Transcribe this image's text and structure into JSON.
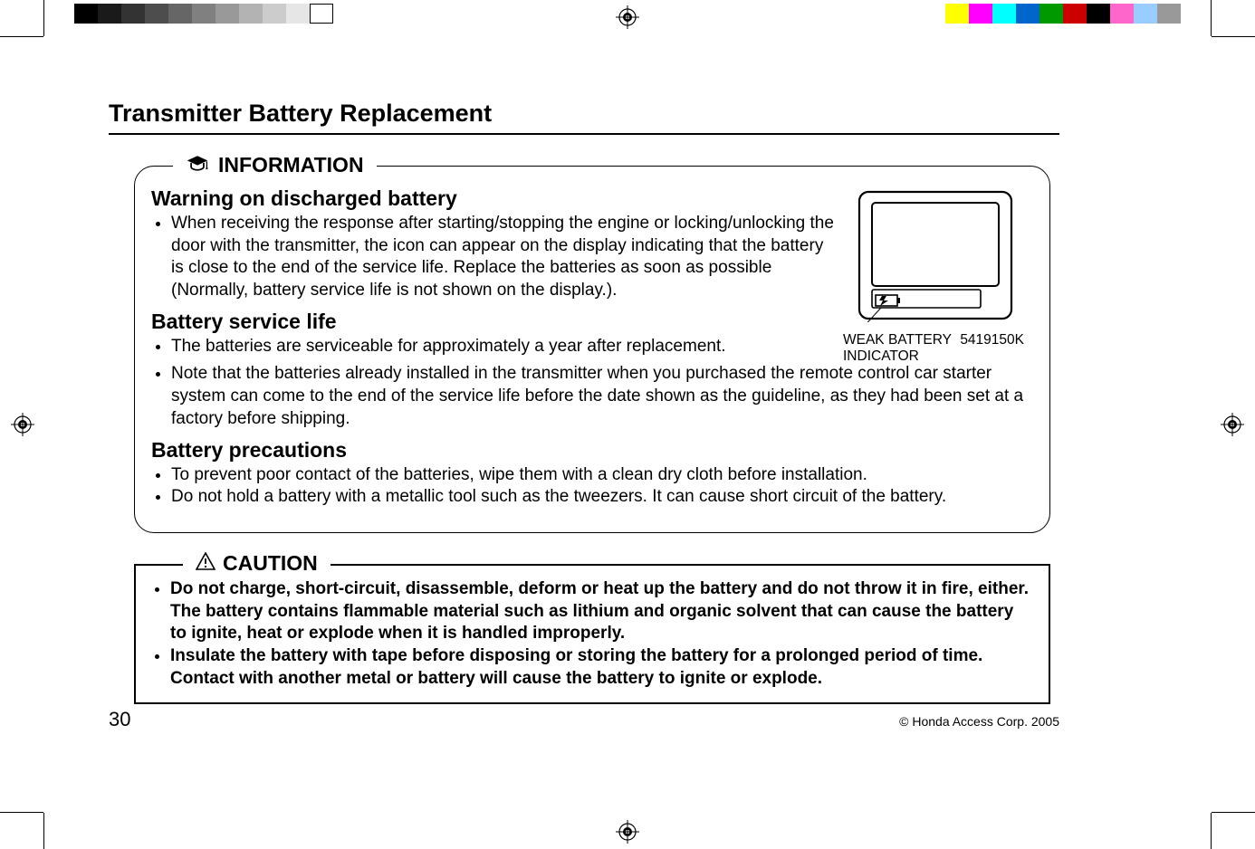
{
  "page_title": "Transmitter Battery Replacement",
  "info": {
    "tab_label": "INFORMATION",
    "sections": [
      {
        "heading": "Warning on discharged battery",
        "bullets": [
          "When receiving the response after starting/stopping the engine or locking/unlocking the door with the transmitter, the icon can appear on the display indicating that the battery is close to the end of the service life. Replace the batteries as soon as possible (Normally, battery service life is not shown on the display.)."
        ]
      },
      {
        "heading": "Battery service life",
        "bullets": [
          "The batteries are serviceable for approximately a year after replacement.",
          "Note that the batteries already installed in the transmitter when you purchased the remote control car starter system can come to the end of the service life before the date shown as the guideline, as they had been set at a factory before shipping."
        ]
      },
      {
        "heading": "Battery precautions",
        "bullets": [
          "To prevent poor contact of the batteries, wipe them with a clean dry cloth before installation.",
          "Do not hold a battery with a metallic tool such as the tweezers. It can cause short circuit of the battery."
        ]
      }
    ],
    "figure": {
      "callout": "WEAK BATTERY INDICATOR",
      "ref": "5419150K"
    }
  },
  "caution": {
    "tab_label": "CAUTION",
    "bullets": [
      "Do not charge, short-circuit, disassemble, deform or heat up the battery and do not throw it in fire, either. The battery contains flammable material such as lithium and organic solvent that can cause the battery to ignite, heat or explode when it is handled improperly.",
      "Insulate the battery with tape before disposing or storing the battery for a prolonged period of time. Contact with another metal or battery will cause the battery to ignite or explode."
    ]
  },
  "footer": {
    "page_number": "30",
    "copyright": "© Honda Access Corp. 2005"
  }
}
